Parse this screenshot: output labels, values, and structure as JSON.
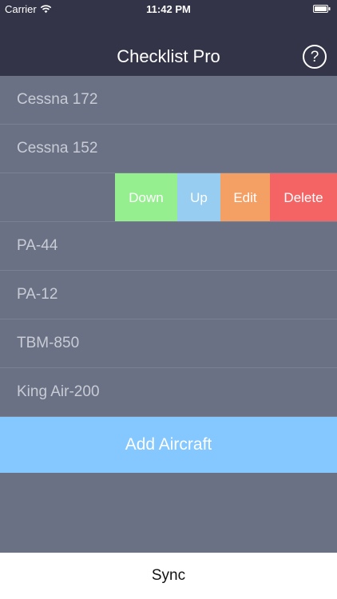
{
  "status_bar": {
    "carrier": "Carrier",
    "time": "11:42 PM",
    "wifi_icon": "wifi-icon",
    "battery_icon": "battery-icon"
  },
  "header": {
    "title": "Checklist Pro",
    "help_label": "?",
    "help_icon": "question-circle-icon"
  },
  "aircraft": [
    {
      "name": "Cessna 172"
    },
    {
      "name": "Cessna 152"
    },
    {
      "name": ""
    },
    {
      "name": "PA-44"
    },
    {
      "name": "PA-12"
    },
    {
      "name": "TBM-850"
    },
    {
      "name": "King Air-200"
    }
  ],
  "swipe_actions": {
    "down": "Down",
    "up": "Up",
    "edit": "Edit",
    "delete": "Delete"
  },
  "add_button": {
    "label": "Add Aircraft"
  },
  "bottom_bar": {
    "sync_label": "Sync"
  },
  "colors": {
    "header_background": "#333448",
    "list_background": "#6a7184",
    "down_action": "#95ef8f",
    "up_action": "#96cdf1",
    "edit_action": "#f49f63",
    "delete_action": "#f56464",
    "add_button": "#84c8ff"
  }
}
